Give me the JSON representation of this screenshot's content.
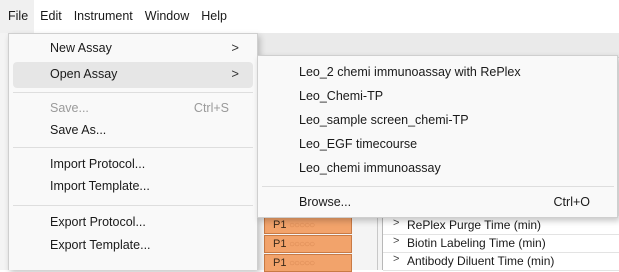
{
  "menubar": {
    "items": [
      "File",
      "Edit",
      "Instrument",
      "Window",
      "Help"
    ]
  },
  "file_menu": {
    "items": [
      {
        "label": "New Assay",
        "submenu": true
      },
      {
        "label": "Open Assay",
        "submenu": true,
        "highlighted": true
      },
      {
        "label": "Save...",
        "shortcut": "Ctrl+S",
        "disabled": true
      },
      {
        "label": "Save As..."
      },
      {
        "label": "Import Protocol..."
      },
      {
        "label": "Import Template..."
      },
      {
        "label": "Export Protocol..."
      },
      {
        "label": "Export Template..."
      }
    ]
  },
  "open_assay_submenu": {
    "recent": [
      "Leo_2 chemi immunoassay with RePlex",
      "Leo_Chemi-TP",
      "Leo_sample screen_chemi-TP",
      "Leo_EGF timecourse",
      "Leo_chemi immunoassay"
    ],
    "browse_label": "Browse...",
    "browse_shortcut": "Ctrl+O"
  },
  "plate": {
    "rows": [
      "P1",
      "P1",
      "P1"
    ]
  },
  "protocol_list": {
    "items": [
      "RePlex Purge Time (min)",
      "Biotin Labeling Time (min)",
      "Antibody Diluent Time (min)"
    ]
  },
  "colors": {
    "well_fill": "#f2a36b",
    "highlight": "#e6e6e6",
    "disabled_text": "#9a9a9a"
  }
}
